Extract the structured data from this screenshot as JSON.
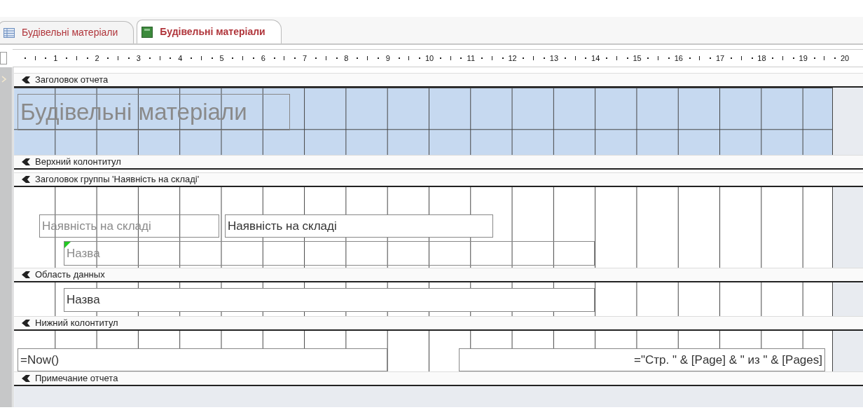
{
  "tabs": [
    {
      "label": "Будівельні матеріали",
      "kind": "table",
      "selected": false
    },
    {
      "label": "Будівельні матеріали",
      "kind": "report",
      "selected": true
    }
  ],
  "ruler": [
    "1",
    "2",
    "3",
    "4",
    "5",
    "6",
    "7",
    "8",
    "9",
    "10",
    "11",
    "12",
    "13",
    "14",
    "15",
    "16",
    "17",
    "18",
    "19",
    "20"
  ],
  "sections": [
    {
      "title": "Заголовок отчета",
      "color": "#c6d9f0",
      "controls": [
        {
          "kind": "title",
          "text": "Будівельні матеріали",
          "warning": false
        }
      ]
    },
    {
      "title": "Верхний колонтитул"
    },
    {
      "title": "Заголовок группы 'Наявність на складі'",
      "color": "#ffffff",
      "controls": [
        {
          "kind": "label",
          "text": "Наявність на складі",
          "warning": false
        },
        {
          "kind": "textbox",
          "text": "Наявність на складі",
          "warning": false
        },
        {
          "kind": "label",
          "text": "Назва",
          "warning": true
        }
      ]
    },
    {
      "title": "Область данных",
      "color": "#ffffff",
      "controls": [
        {
          "kind": "textbox",
          "text": "Назва",
          "warning": false
        }
      ]
    },
    {
      "title": "Нижний колонтитул",
      "color": "#ffffff",
      "controls": [
        {
          "kind": "textbox",
          "text": "=Now()",
          "warning": false
        },
        {
          "kind": "pagenumber",
          "text": "=\"Стр. \" & [Page] & \" из \" & [Pages]",
          "warning": false
        }
      ]
    },
    {
      "title": "Примечание отчета"
    }
  ]
}
